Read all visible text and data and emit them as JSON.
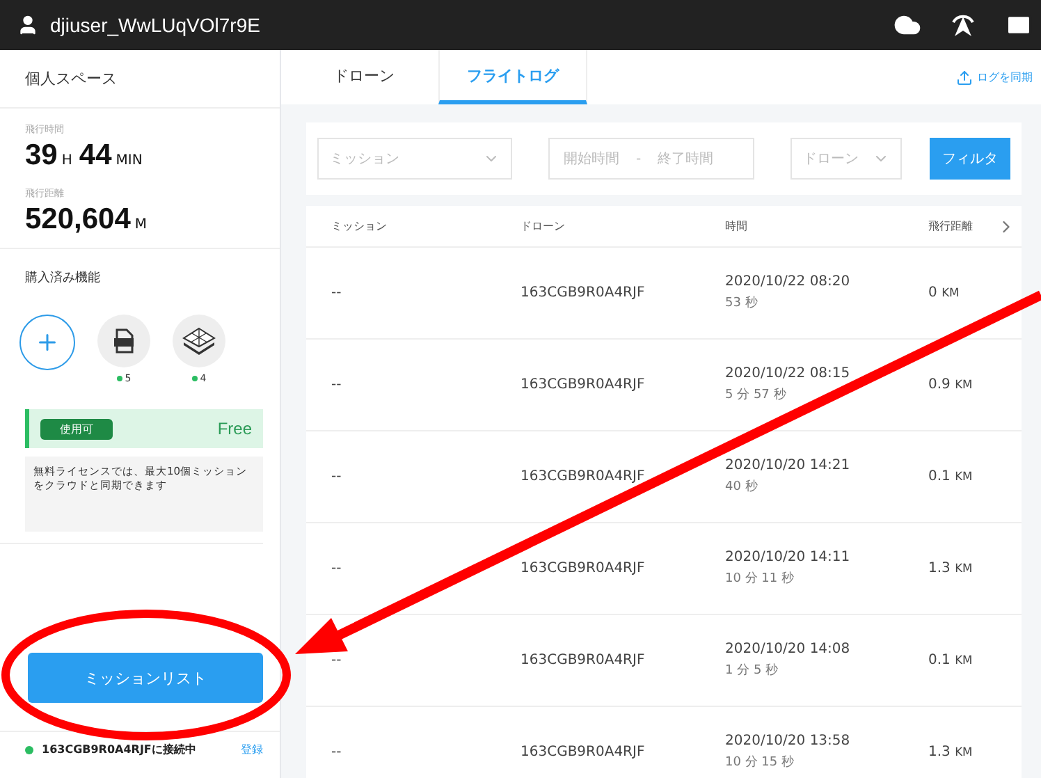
{
  "top_bar": {
    "username": "djiuser_WwLUqVOl7r9E"
  },
  "sidebar": {
    "title": "個人スペース",
    "stats": [
      {
        "label": "飛行時間",
        "parts": [
          {
            "value": "39",
            "unit": "H"
          },
          {
            "value": "44",
            "unit": "MIN"
          }
        ]
      },
      {
        "label": "飛行距離",
        "parts": [
          {
            "value": "520,604",
            "unit": "M"
          }
        ]
      }
    ],
    "features_title": "購入済み機能",
    "features": [
      {
        "kind": "add"
      },
      {
        "kind": "kml",
        "count": "5"
      },
      {
        "kind": "layers",
        "count": "4"
      }
    ],
    "license": {
      "badge": "使用可",
      "plan": "Free",
      "note": "無料ライセンスでは、最大10個ミッションをクラウドと同期できます"
    },
    "mission_list_button": "ミッションリスト",
    "connection": {
      "text": "163CGB9R0A4RJFに接続中",
      "connected": true,
      "link": "登録"
    }
  },
  "tabs": [
    {
      "label": "ドローン",
      "selected": false
    },
    {
      "label": "フライトログ",
      "selected": true
    }
  ],
  "sync_link": "ログを同期",
  "filters": {
    "mission": {
      "placeholder": "ミッション"
    },
    "start": {
      "placeholder": "開始時間"
    },
    "separator": "-",
    "end": {
      "placeholder": "終了時間"
    },
    "drone": {
      "placeholder": "ドローン"
    },
    "button": "フィルタ"
  },
  "table": {
    "columns": [
      "ミッション",
      "ドローン",
      "時間",
      "飛行距離"
    ],
    "rows": [
      {
        "mission": "--",
        "drone": "163CGB9R0A4RJF",
        "date": "2020/10/22 08:20",
        "duration": "53 秒",
        "distance": "0",
        "unit": "KM"
      },
      {
        "mission": "--",
        "drone": "163CGB9R0A4RJF",
        "date": "2020/10/22 08:15",
        "duration": "5 分 57 秒",
        "distance": "0.9",
        "unit": "KM"
      },
      {
        "mission": "--",
        "drone": "163CGB9R0A4RJF",
        "date": "2020/10/20 14:21",
        "duration": "40 秒",
        "distance": "0.1",
        "unit": "KM"
      },
      {
        "mission": "--",
        "drone": "163CGB9R0A4RJF",
        "date": "2020/10/20 14:11",
        "duration": "10 分 11 秒",
        "distance": "1.3",
        "unit": "KM"
      },
      {
        "mission": "--",
        "drone": "163CGB9R0A4RJF",
        "date": "2020/10/20 14:08",
        "duration": "1 分 5 秒",
        "distance": "0.1",
        "unit": "KM"
      },
      {
        "mission": "--",
        "drone": "163CGB9R0A4RJF",
        "date": "2020/10/20 13:58",
        "duration": "10 分 15 秒",
        "distance": "1.3",
        "unit": "KM"
      }
    ]
  }
}
